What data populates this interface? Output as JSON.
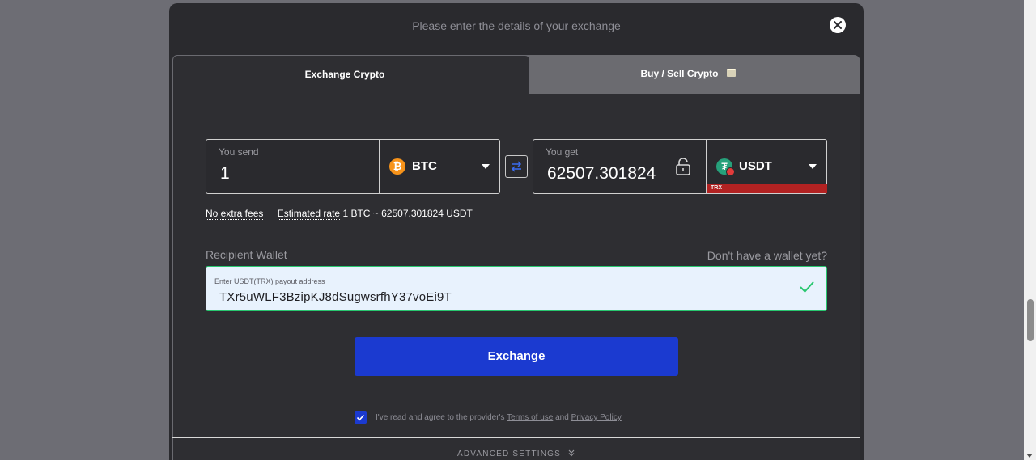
{
  "modal": {
    "title": "Please enter the details of your exchange"
  },
  "tabs": [
    {
      "label": "Exchange Crypto",
      "active": true
    },
    {
      "label": "Buy / Sell Crypto",
      "active": false
    }
  ],
  "send": {
    "label": "You send",
    "amount": "1",
    "currency": "BTC",
    "currency_icon": "bitcoin-icon",
    "currency_color": "#f7931a"
  },
  "get": {
    "label": "You get",
    "amount": "62507.301824",
    "currency": "USDT",
    "network": "TRX",
    "currency_icon": "tether-icon",
    "currency_color": "#26a17b",
    "network_color": "#b22222"
  },
  "info": {
    "fees": "No extra fees",
    "rate_label": "Estimated rate",
    "rate_value": "1 BTC ~ 62507.301824 USDT"
  },
  "wallet": {
    "label": "Recipient Wallet",
    "no_wallet_link": "Don't have a wallet yet?",
    "placeholder": "Enter USDT(TRX) payout address",
    "value": "TXr5uWLF3BzipKJ8dSugwsrfhY37voEi9T",
    "valid": true
  },
  "actions": {
    "exchange_label": "Exchange"
  },
  "agreement": {
    "checked": true,
    "prefix": "I've read and agree to the provider's ",
    "terms": "Terms of use",
    "and": " and ",
    "privacy": "Privacy Policy"
  },
  "advanced": {
    "label": "ADVANCED SETTINGS"
  },
  "colors": {
    "accent": "#1b3ad0",
    "success": "#28c76f",
    "background": "#2a2a2e"
  }
}
